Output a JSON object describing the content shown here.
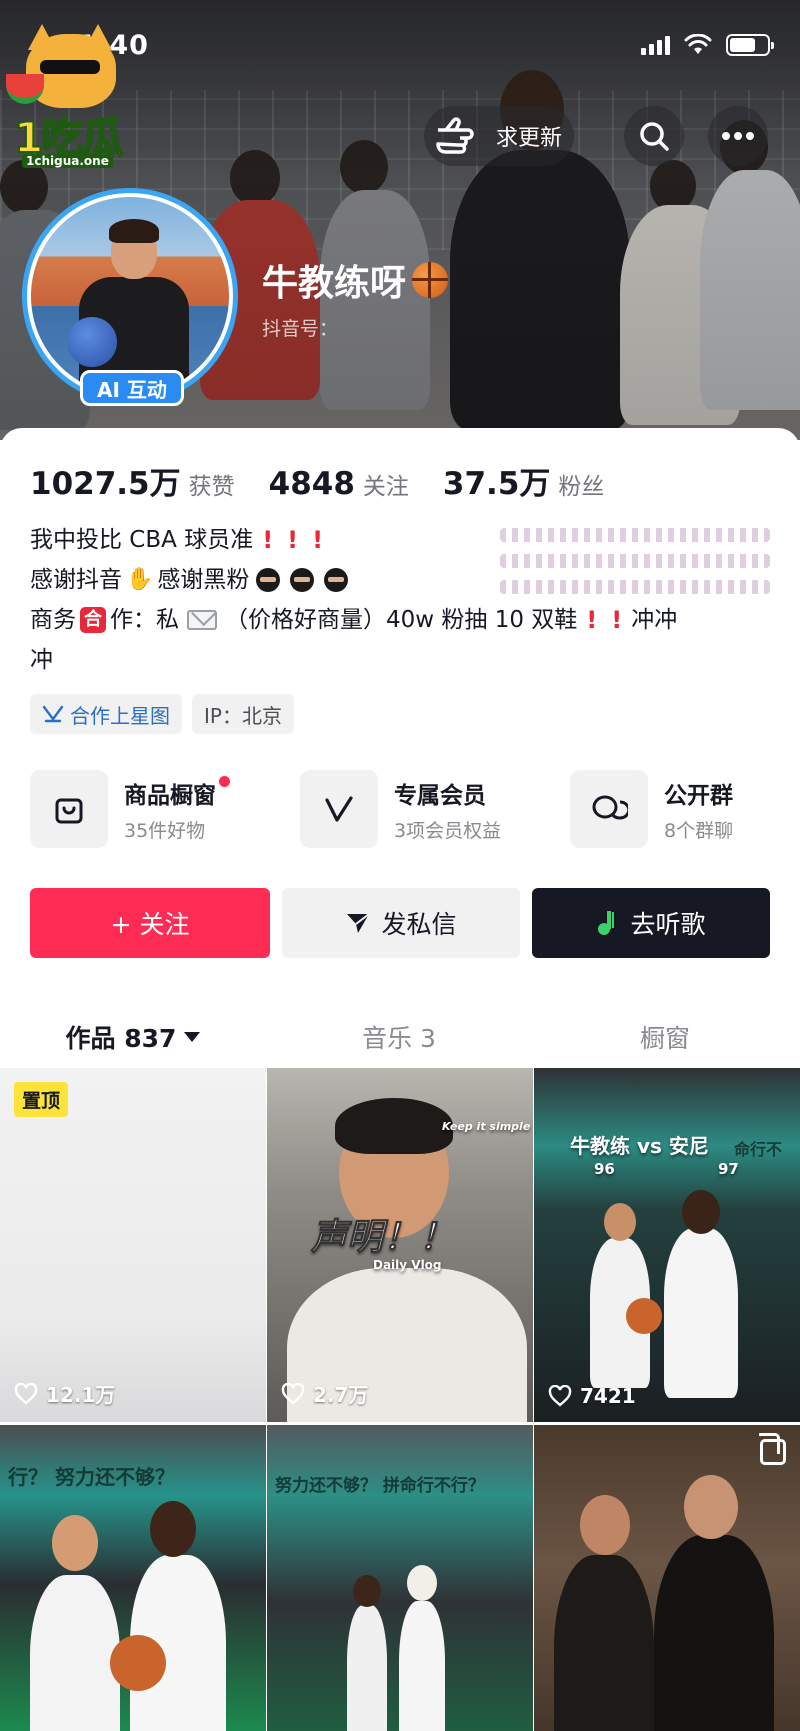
{
  "status_bar": {
    "time": "11:40"
  },
  "logo": {
    "brand": "1吃瓜",
    "domain": "1chigua.one"
  },
  "header": {
    "urge_update_label": "求更新",
    "ai_badge": "AI 互动",
    "nickname": "牛教练呀",
    "douyin_id_label": "抖音号："
  },
  "stats": [
    {
      "value": "1027.5万",
      "label": "获赞"
    },
    {
      "value": "4848",
      "label": "关注"
    },
    {
      "value": "37.5万",
      "label": "粉丝"
    }
  ],
  "bio": {
    "line1": "我中投比 CBA 球员准",
    "line2a": "感谢抖音",
    "line2b": "感谢黑粉",
    "line3a": "商务",
    "line3_badge": "合",
    "line3b": "作：私",
    "line3c": "（价格好商量）40w 粉抽 10 双鞋",
    "line3d": "冲冲",
    "line4": "冲"
  },
  "tags": [
    {
      "label": "合作上星图",
      "icon": "star-map-icon"
    },
    {
      "label": "IP：北京"
    }
  ],
  "services": [
    {
      "title": "商品橱窗",
      "subtitle": "35件好物",
      "icon": "shopping-bag-icon",
      "has_dot": true
    },
    {
      "title": "专属会员",
      "subtitle": "3项会员权益",
      "icon": "v-member-icon"
    },
    {
      "title": "公开群",
      "subtitle": "8个群聊",
      "icon": "group-chat-icon"
    }
  ],
  "actions": {
    "follow": "+ 关注",
    "message": "发私信",
    "music": "去听歌"
  },
  "tabs": [
    {
      "label": "作品 837",
      "active": true
    },
    {
      "label": "音乐 3"
    },
    {
      "label": "橱窗"
    }
  ],
  "videos": [
    {
      "likes": "12.1万",
      "pinned_label": "置顶"
    },
    {
      "likes": "2.7万",
      "overlay": "声明！！",
      "caption": "Keep it simple",
      "caption2": "Daily Vlog"
    },
    {
      "likes": "7421",
      "overlay": "牛教练 vs 安尼",
      "score_left": "96",
      "score_right": "97",
      "wall_text": "命行不"
    },
    {
      "likes": "",
      "wall_text": "行？    努力还不够？"
    },
    {
      "likes": "",
      "wall_text": "努力还不够？ 拼命行不行？"
    },
    {
      "likes": ""
    }
  ],
  "colors": {
    "accent_red": "#fe2c55",
    "dark": "#161823",
    "avatar_ring": "#3aa5f5"
  }
}
